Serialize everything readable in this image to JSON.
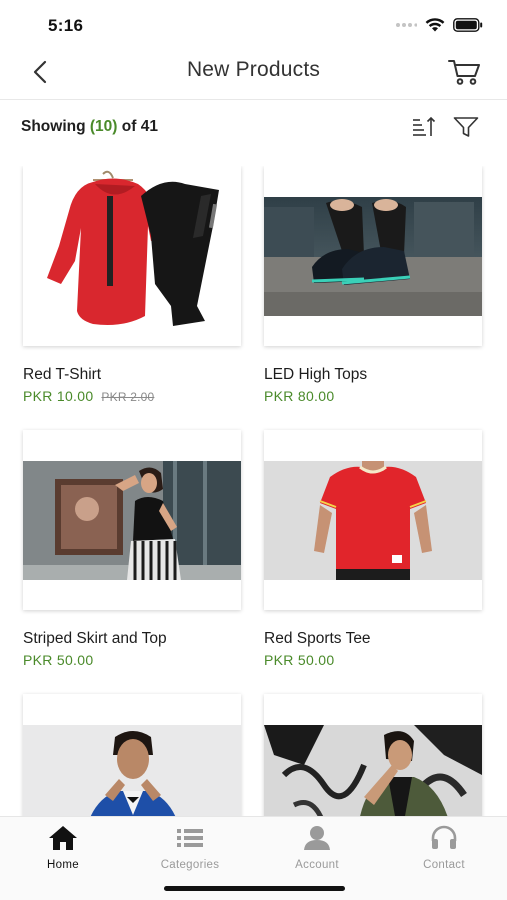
{
  "status_bar": {
    "time": "5:16"
  },
  "nav": {
    "title": "New Products"
  },
  "toolbar": {
    "showing_prefix": "Showing",
    "showing_count": "(10)",
    "showing_suffix": "of 41"
  },
  "products": [
    {
      "name": "Red T-Shirt",
      "price": "PKR 10.00",
      "old_price": "PKR 2.00"
    },
    {
      "name": "LED High Tops",
      "price": "PKR 80.00"
    },
    {
      "name": "Striped Skirt and Top",
      "price": "PKR 50.00"
    },
    {
      "name": "Red Sports Tee",
      "price": "PKR 50.00"
    },
    {
      "name": "",
      "price": ""
    },
    {
      "name": "",
      "price": ""
    }
  ],
  "tabs": [
    {
      "label": "Home",
      "icon": "home-icon",
      "active": true
    },
    {
      "label": "Categories",
      "icon": "list-icon",
      "active": false
    },
    {
      "label": "Account",
      "icon": "person-icon",
      "active": false
    },
    {
      "label": "Contact",
      "icon": "headphones-icon",
      "active": false
    }
  ],
  "colors": {
    "price_green": "#4a8a2a",
    "text_dark": "#1f1f1f",
    "tab_inactive": "#9a9a9a"
  }
}
